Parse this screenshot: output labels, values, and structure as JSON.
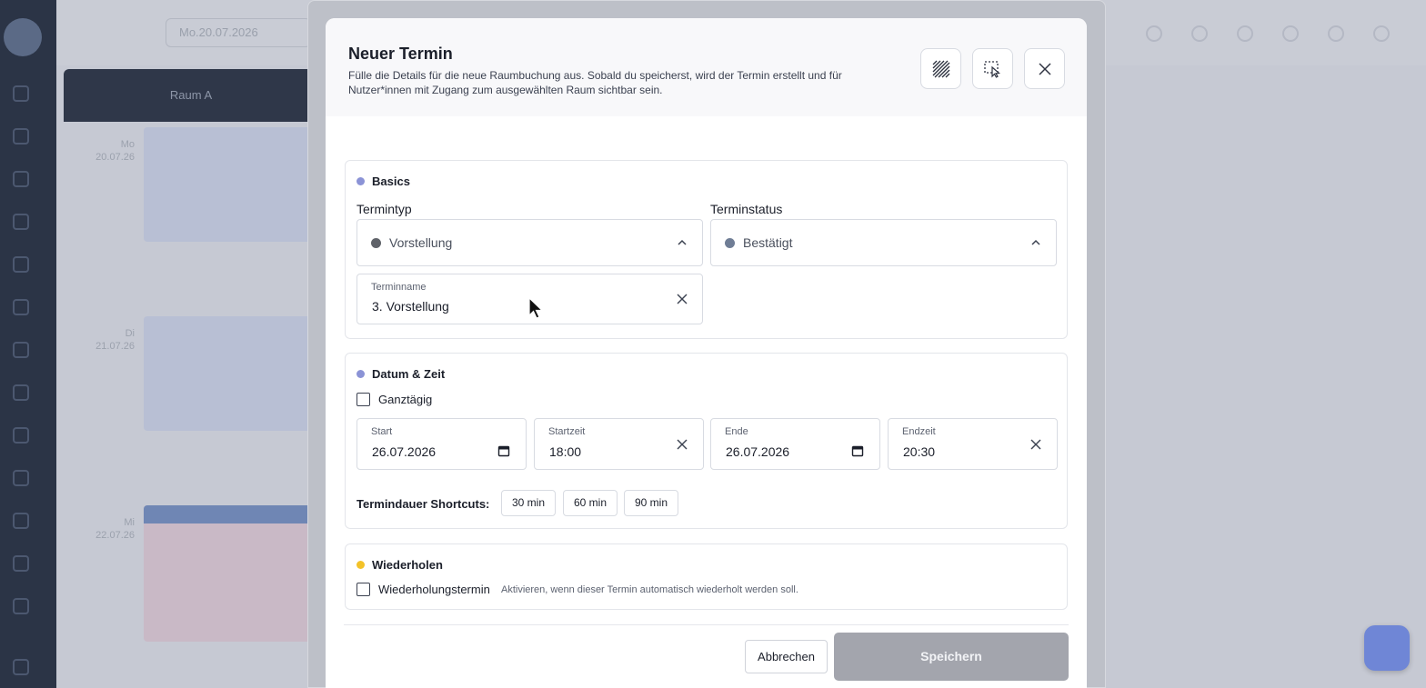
{
  "background": {
    "date_value": "Mo.20.07.2026",
    "room_column": "Raum A",
    "days": [
      {
        "weekday": "Mo",
        "date": "20.07.26"
      },
      {
        "weekday": "Di",
        "date": "21.07.26"
      },
      {
        "weekday": "Mi",
        "date": "22.07.26"
      }
    ]
  },
  "modal": {
    "title": "Neuer Termin",
    "description": "Fülle die Details für die neue Raumbuchung aus. Sobald du speicherst, wird der Termin erstellt und für Nutzer*innen mit Zugang zum ausgewählten Raum sichtbar sein.",
    "header_buttons": [
      {
        "icon": "hatch-pattern-icon"
      },
      {
        "icon": "select-cursor-icon"
      },
      {
        "icon": "close-icon"
      }
    ],
    "basics": {
      "title": "Basics",
      "dot_color": "#8b93d6",
      "termintyp": {
        "label": "Termintyp",
        "value": "Vorstellung",
        "dot_color": "#5f6269"
      },
      "terminstatus": {
        "label": "Terminstatus",
        "value": "Bestätigt",
        "dot_color": "#6f7d95"
      },
      "terminname": {
        "label": "Terminname",
        "value": "3. Vorstellung"
      }
    },
    "datum_zeit": {
      "title": "Datum & Zeit",
      "dot_color": "#8b93d6",
      "ganztaegig": {
        "label": "Ganztägig",
        "checked": false
      },
      "start": {
        "label": "Start",
        "value": "26.07.2026"
      },
      "startzeit": {
        "label": "Startzeit",
        "value": "18:00"
      },
      "ende": {
        "label": "Ende",
        "value": "26.07.2026"
      },
      "endzeit": {
        "label": "Endzeit",
        "value": "20:30"
      },
      "shortcuts_label": "Termindauer Shortcuts:",
      "shortcuts": [
        "30 min",
        "60 min",
        "90 min"
      ]
    },
    "wiederholen": {
      "title": "Wiederholen",
      "dot_color": "#f3c228",
      "checkbox_label": "Wiederholungstermin",
      "checked": false,
      "hint": "Aktivieren, wenn dieser Termin automatisch wiederholt werden soll."
    },
    "footer": {
      "cancel_label": "Abbrechen",
      "save_label": "Speichern",
      "save_enabled": false
    }
  }
}
